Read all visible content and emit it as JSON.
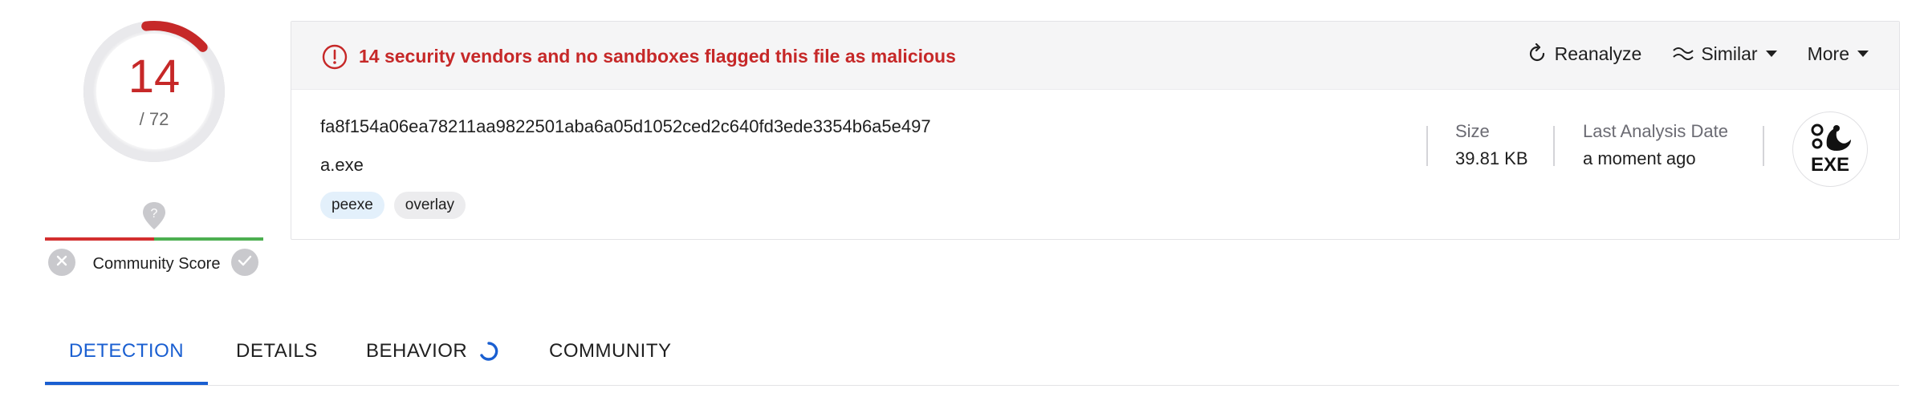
{
  "score": {
    "detections": "14",
    "total": "/ 72",
    "detection_ratio": 0.1944,
    "color": "#c62828"
  },
  "community": {
    "label": "Community Score",
    "icon_unknown": "question-mark-icon",
    "icon_down": "x-icon",
    "icon_up": "check-icon"
  },
  "banner": {
    "alert_text": "14 security vendors and no sandboxes flagged this file as malicious",
    "alert_icon": "alert-circle-icon",
    "actions": {
      "reanalyze": "Reanalyze",
      "similar": "Similar",
      "more": "More"
    }
  },
  "file": {
    "hash": "fa8f154a06ea78211aa9822501aba6a05d1052ced2c640fd3ede3354b6a5e497",
    "name": "a.exe",
    "tags": [
      "peexe",
      "overlay"
    ],
    "size_label": "Size",
    "size_value": "39.81 KB",
    "date_label": "Last Analysis Date",
    "date_value": "a moment ago",
    "type_label": "EXE",
    "type_icon": "exe-file-icon"
  },
  "tabs": [
    {
      "label": "DETECTION",
      "active": true
    },
    {
      "label": "DETAILS",
      "active": false
    },
    {
      "label": "BEHAVIOR",
      "active": false
    },
    {
      "label": "COMMUNITY",
      "active": false
    }
  ],
  "colors": {
    "malicious": "#c62828",
    "accent": "#1a5fd1",
    "positive": "#4caf50",
    "negative": "#d32f2f"
  }
}
